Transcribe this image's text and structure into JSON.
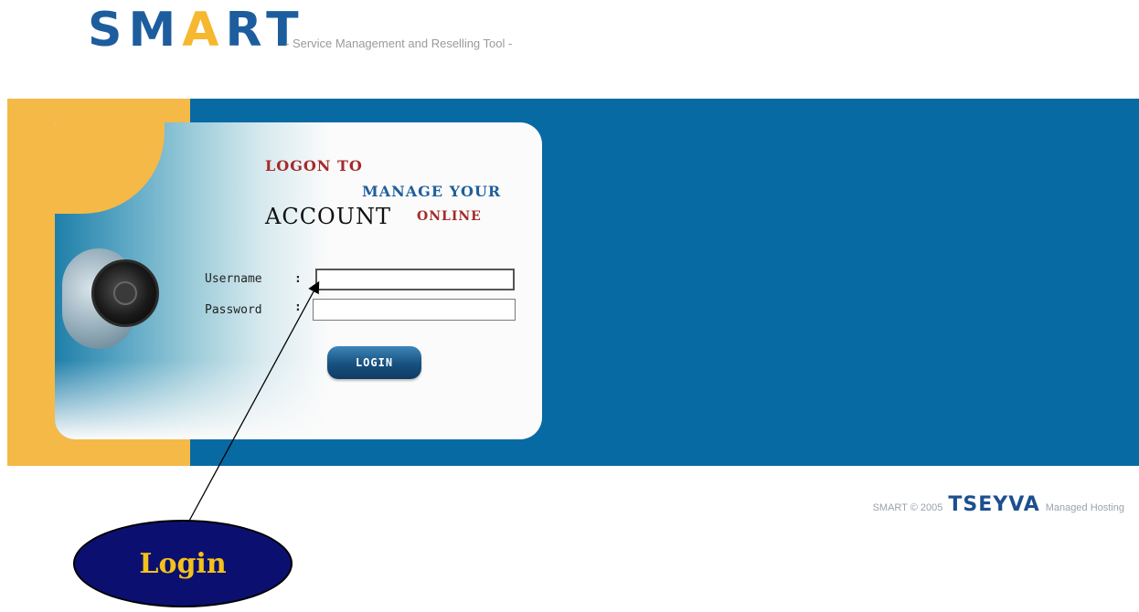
{
  "header": {
    "logo_prefix": "SM",
    "logo_accent": "A",
    "logo_suffix": "RT",
    "tagline": "- Service Management and Reselling Tool -"
  },
  "card": {
    "headline_logon": "LOGON TO",
    "headline_manage": "MANAGE YOUR",
    "headline_account": "ACCOUNT",
    "headline_online": "ONLINE"
  },
  "form": {
    "username_label": "Username",
    "password_label": "Password",
    "colon": ":",
    "username_value": "",
    "password_value": "",
    "login_label": "LOGIN"
  },
  "footer": {
    "copyright": "SMART © 2005",
    "brand": "TSEYVA",
    "tagline": "Managed Hosting"
  },
  "annotation": {
    "label": "Login"
  },
  "colors": {
    "banner_blue": "#076aa3",
    "banner_yellow": "#f5b947",
    "logo_blue": "#1d5d9e",
    "accent_red": "#a52a2a",
    "callout_navy": "#0b1070",
    "callout_text": "#f3c21b"
  }
}
